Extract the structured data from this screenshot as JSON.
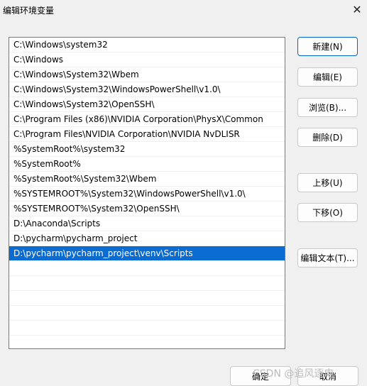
{
  "window": {
    "title": "编辑环境变量"
  },
  "paths": [
    "C:\\Windows\\system32",
    "C:\\Windows",
    "C:\\Windows\\System32\\Wbem",
    "C:\\Windows\\System32\\WindowsPowerShell\\v1.0\\",
    "C:\\Windows\\System32\\OpenSSH\\",
    "C:\\Program Files (x86)\\NVIDIA Corporation\\PhysX\\Common",
    "C:\\Program Files\\NVIDIA Corporation\\NVIDIA NvDLISR",
    "%SystemRoot%\\system32",
    "%SystemRoot%",
    "%SystemRoot%\\System32\\Wbem",
    "%SYSTEMROOT%\\System32\\WindowsPowerShell\\v1.0\\",
    "%SYSTEMROOT%\\System32\\OpenSSH\\",
    "D:\\Anaconda\\Scripts",
    "D:\\pycharm\\pycharm_project",
    "D:\\pycharm\\pycharm_project\\venv\\Scripts"
  ],
  "selected_index": 14,
  "buttons": {
    "new": "新建(N)",
    "edit": "编辑(E)",
    "browse": "浏览(B)...",
    "delete": "删除(D)",
    "up": "上移(U)",
    "down": "下移(O)",
    "edit_text": "编辑文本(T)..."
  },
  "footer": {
    "ok": "确定",
    "cancel": "取消"
  },
  "watermark": "CSDN @追风逐电",
  "colors": {
    "selection": "#0a6bd0",
    "accent_border": "#0067c0"
  }
}
